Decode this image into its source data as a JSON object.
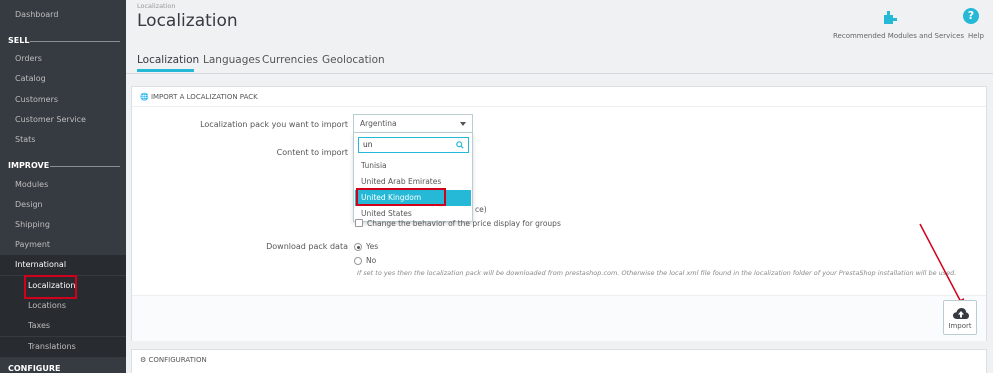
{
  "sidebar": {
    "dashboard": "Dashboard",
    "sell_section": "SELL",
    "sell_items": [
      "Orders",
      "Catalog",
      "Customers",
      "Customer Service",
      "Stats"
    ],
    "improve_section": "IMPROVE",
    "improve_items": [
      "Modules",
      "Design",
      "Shipping",
      "Payment",
      "International"
    ],
    "international_sub": [
      "Localization",
      "Locations",
      "Taxes",
      "Translations"
    ],
    "configure_section": "CONFIGURE"
  },
  "header": {
    "breadcrumb": "Localization",
    "title": "Localization",
    "recommended_label": "Recommended Modules and Services",
    "help_label": "Help",
    "help_icon_glyph": "?"
  },
  "tabs": [
    "Localization",
    "Languages",
    "Currencies",
    "Geolocation"
  ],
  "import_panel": {
    "heading": "IMPORT A LOCALIZATION PACK",
    "pack_label": "Localization pack you want to import",
    "pack_value": "Argentina",
    "content_label": "Content to import",
    "search_value": "un",
    "dropdown_options": [
      "Tunisia",
      "United Arab Emirates",
      "United Kingdom",
      "United States"
    ],
    "selected_option": "United Kingdom",
    "partial_text_1": "ce)",
    "partial_text_2": "Change the behavior of the price display for groups",
    "download_label": "Download pack data",
    "radio_yes": "Yes",
    "radio_no": "No",
    "download_value": "Yes",
    "help_text": "If set to yes then the localization pack will be downloaded from prestashop.com. Otherwise the local xml file found in the localization folder of your PrestaShop installation will be used.",
    "import_button": "Import"
  },
  "config_panel": {
    "heading": "CONFIGURATION"
  },
  "colors": {
    "accent": "#25b9d7",
    "highlight_box": "#d0021b",
    "sidebar_bg": "#363a41"
  }
}
